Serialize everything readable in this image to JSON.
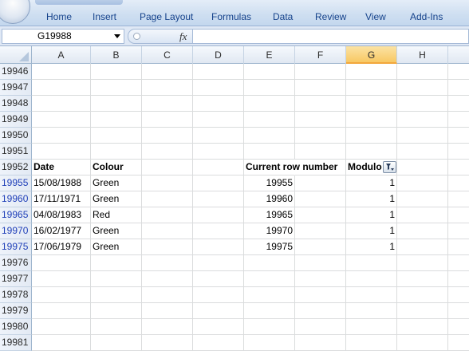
{
  "ribbon": {
    "tabs": [
      "Home",
      "Insert",
      "Page Layout",
      "Formulas",
      "Data",
      "Review",
      "View",
      "Add-Ins"
    ]
  },
  "formula_bar": {
    "name_box": "G19988",
    "fx_label": "fx",
    "formula": ""
  },
  "columns": [
    "A",
    "B",
    "C",
    "D",
    "E",
    "F",
    "G",
    "H"
  ],
  "selected_column": "G",
  "rows": [
    {
      "num": "19946",
      "filtered": false,
      "cells": {}
    },
    {
      "num": "19947",
      "filtered": false,
      "cells": {}
    },
    {
      "num": "19948",
      "filtered": false,
      "cells": {}
    },
    {
      "num": "19949",
      "filtered": false,
      "cells": {}
    },
    {
      "num": "19950",
      "filtered": false,
      "cells": {}
    },
    {
      "num": "19951",
      "filtered": false,
      "cells": {}
    },
    {
      "num": "19952",
      "filtered": false,
      "header": true,
      "cells": {
        "A": "Date",
        "B": "Colour",
        "E": "Current row number",
        "G": "Modulo"
      }
    },
    {
      "num": "19955",
      "filtered": true,
      "cells": {
        "A": "15/08/1988",
        "B": "Green",
        "E": "19955",
        "G": "1"
      }
    },
    {
      "num": "19960",
      "filtered": true,
      "cells": {
        "A": "17/11/1971",
        "B": "Green",
        "E": "19960",
        "G": "1"
      }
    },
    {
      "num": "19965",
      "filtered": true,
      "cells": {
        "A": "04/08/1983",
        "B": "Red",
        "E": "19965",
        "G": "1"
      }
    },
    {
      "num": "19970",
      "filtered": true,
      "cells": {
        "A": "16/02/1977",
        "B": "Green",
        "E": "19970",
        "G": "1"
      }
    },
    {
      "num": "19975",
      "filtered": true,
      "cells": {
        "A": "17/06/1979",
        "B": "Green",
        "E": "19975",
        "G": "1"
      }
    },
    {
      "num": "19976",
      "filtered": false,
      "cells": {}
    },
    {
      "num": "19977",
      "filtered": false,
      "cells": {}
    },
    {
      "num": "19978",
      "filtered": false,
      "cells": {}
    },
    {
      "num": "19979",
      "filtered": false,
      "cells": {}
    },
    {
      "num": "19980",
      "filtered": false,
      "cells": {}
    },
    {
      "num": "19981",
      "filtered": false,
      "cells": {}
    }
  ],
  "icons": {
    "office_button": "office-logo-icon",
    "filter": "autofilter-active-icon",
    "name_box_dropdown": "chevron-down-icon"
  },
  "colors": {
    "tab_text": "#15428b",
    "filtered_row_number": "#1f3fb8",
    "selected_column_header": "#f8c863"
  }
}
